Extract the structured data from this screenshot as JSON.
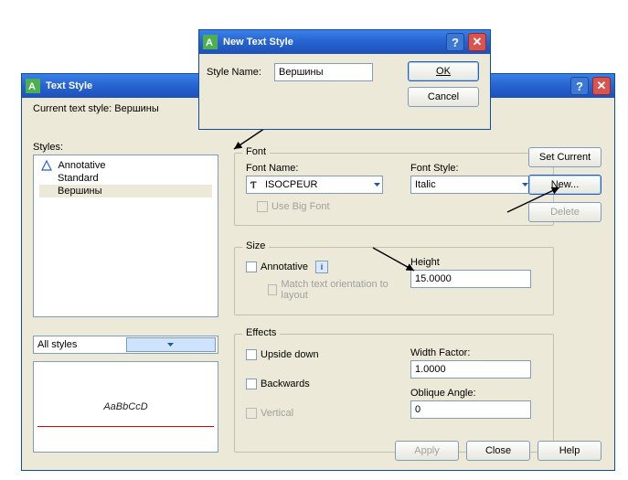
{
  "main": {
    "title": "Text Style",
    "current_label": "Current text style:",
    "current_value": "Вершины",
    "styles_label": "Styles:",
    "styles": {
      "annotative": "Annotative",
      "standard": "Standard",
      "selected": "Вершины"
    },
    "filter_value": "All styles",
    "preview_sample": "AaBbCcD",
    "buttons": {
      "set_current": "Set Current",
      "new": "New...",
      "delete": "Delete",
      "apply": "Apply",
      "close": "Close",
      "help": "Help"
    }
  },
  "font": {
    "legend": "Font",
    "name_label": "Font Name:",
    "name_value": "ISOCPEUR",
    "style_label": "Font Style:",
    "style_value": "Italic",
    "big_font": "Use Big Font"
  },
  "size": {
    "legend": "Size",
    "annotative_label": "Annotative",
    "match_label": "Match text orientation to layout",
    "height_label": "Height",
    "height_value": "15.0000"
  },
  "effects": {
    "legend": "Effects",
    "upside": "Upside down",
    "backwards": "Backwards",
    "vertical": "Vertical",
    "width_label": "Width Factor:",
    "width_value": "1.0000",
    "oblique_label": "Oblique Angle:",
    "oblique_value": "0"
  },
  "new_dialog": {
    "title": "New Text Style",
    "name_label": "Style Name:",
    "name_value": "Вершины",
    "ok": "OK",
    "cancel": "Cancel"
  }
}
